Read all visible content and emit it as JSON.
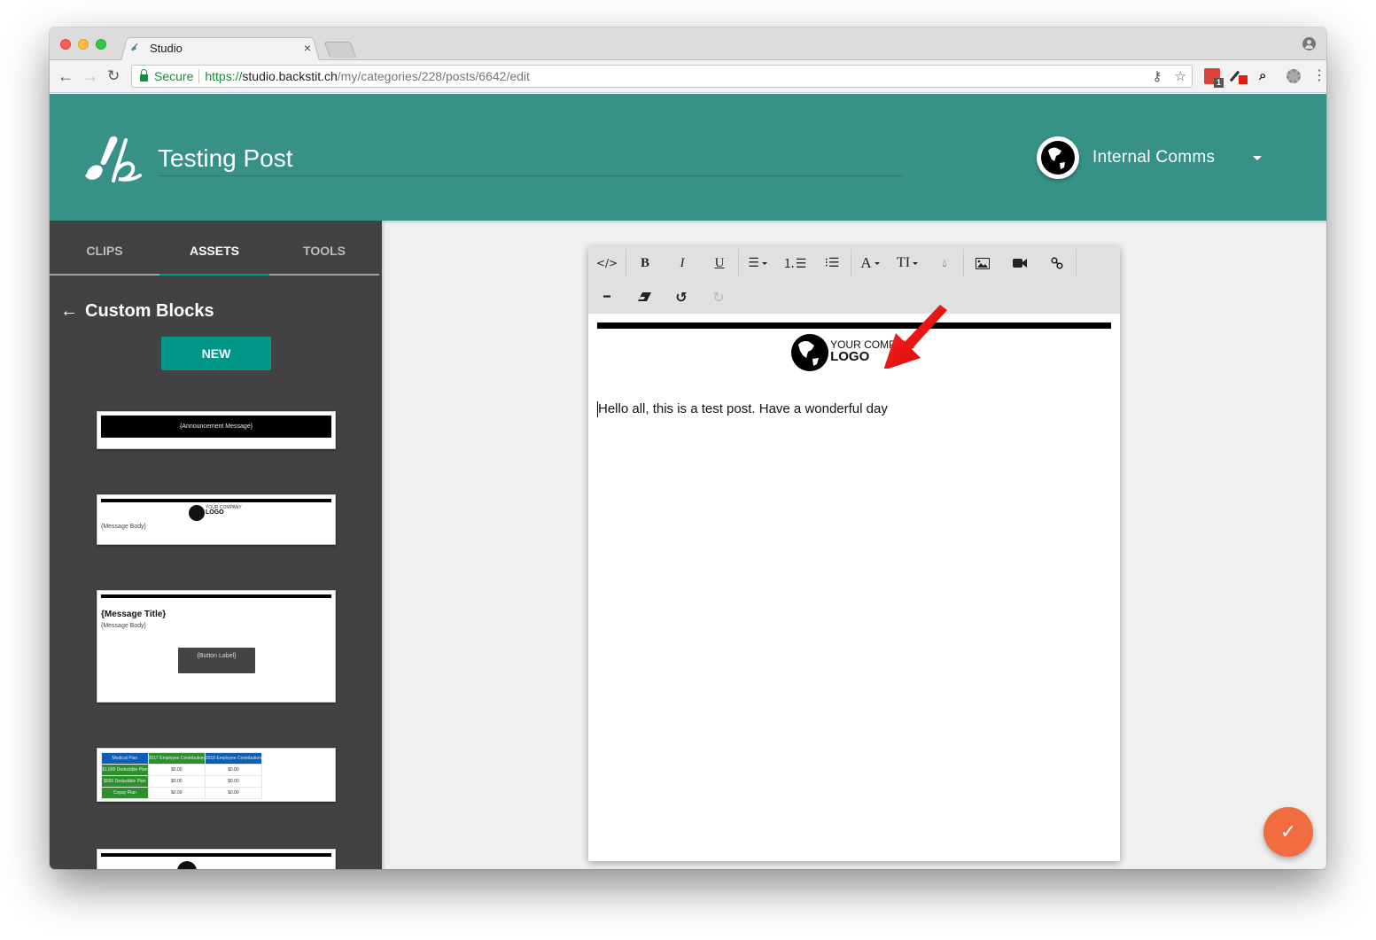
{
  "browser": {
    "tab_title": "Studio",
    "tab_close": "×",
    "secure_label": "Secure",
    "url_scheme": "https://",
    "url_host": "studio.backstit.ch",
    "url_path": "/my/categories/228/posts/6642/edit",
    "extension_badge": "1",
    "icons": [
      "back-arrow-icon",
      "forward-arrow-icon",
      "reload-icon",
      "lock-icon",
      "key-icon",
      "star-icon",
      "mail-extension-icon",
      "color-picker-icon",
      "search-extension-icon",
      "gear-extension-icon",
      "menu-dots-icon",
      "profile-icon"
    ]
  },
  "header": {
    "post_title": "Testing Post",
    "account_name": "Internal Comms",
    "brand_color": "#389187"
  },
  "sidebar": {
    "tabs": [
      {
        "label": "CLIPS",
        "active": false
      },
      {
        "label": "ASSETS",
        "active": true
      },
      {
        "label": "TOOLS",
        "active": false
      }
    ],
    "section_title": "Custom Blocks",
    "new_button": "NEW",
    "blocks": {
      "announcement": "{Announcement Message}",
      "logo_small": "YOUR COMPANY",
      "logo_big": "LOGO",
      "message_body": "{Message Body}",
      "message_title": "{Message Title}",
      "button_label": "{Button Label}",
      "table": {
        "headers": [
          "Medical Plan",
          "2017 Employee Contribution",
          "2018 Employee Contribution"
        ],
        "rows": [
          [
            "$1,000 Deductible Plan",
            "$0.00",
            "$0.00"
          ],
          [
            "$500 Deductible Plan",
            "$0.00",
            "$0.00"
          ],
          [
            "Copay Plan",
            "$0.00",
            "$0.00"
          ]
        ]
      }
    }
  },
  "editor": {
    "toolbar_row1": [
      "code-view",
      "bold",
      "italic",
      "underline",
      "align",
      "ordered-list",
      "unordered-list",
      "font-family",
      "font-size",
      "color",
      "image",
      "video",
      "link"
    ],
    "toolbar_row2": [
      "horizontal-rule",
      "clear-format",
      "undo",
      "redo"
    ],
    "glyphs": {
      "code": "</>",
      "bold": "B",
      "italic": "I",
      "underline": "U",
      "font": "A",
      "size": "TI",
      "hr": "━",
      "undo": "↺",
      "redo": "↻"
    },
    "logo_small": "YOUR COMPANY",
    "logo_big": "LOGO",
    "body_text": "Hello all, this is a test post. Have a wonderful day"
  },
  "fab": {
    "icon": "✓",
    "color": "#f26c42"
  }
}
